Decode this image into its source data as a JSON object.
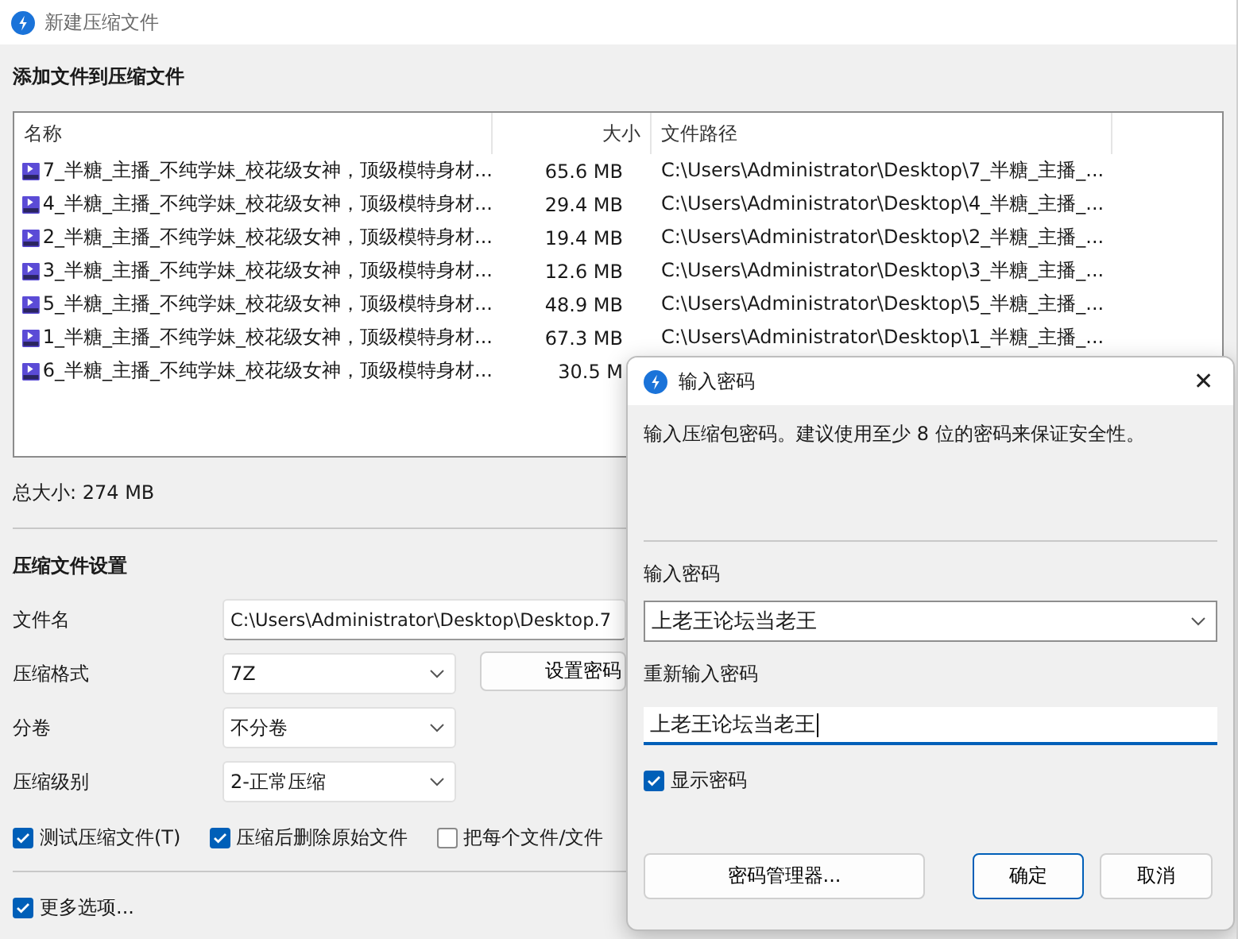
{
  "window": {
    "title": "新建压缩文件"
  },
  "heading": "添加文件到压缩文件",
  "list": {
    "columns": [
      "名称",
      "大小",
      "文件路径"
    ],
    "rows": [
      {
        "name": "7_半糖_主播_不纯学妹_校花级女神，顶级模特身材...",
        "size": "65.6 MB",
        "path": "C:\\Users\\Administrator\\Desktop\\7_半糖_主播_..."
      },
      {
        "name": "4_半糖_主播_不纯学妹_校花级女神，顶级模特身材...",
        "size": "29.4 MB",
        "path": "C:\\Users\\Administrator\\Desktop\\4_半糖_主播_..."
      },
      {
        "name": "2_半糖_主播_不纯学妹_校花级女神，顶级模特身材...",
        "size": "19.4 MB",
        "path": "C:\\Users\\Administrator\\Desktop\\2_半糖_主播_..."
      },
      {
        "name": "3_半糖_主播_不纯学妹_校花级女神，顶级模特身材...",
        "size": "12.6 MB",
        "path": "C:\\Users\\Administrator\\Desktop\\3_半糖_主播_..."
      },
      {
        "name": "5_半糖_主播_不纯学妹_校花级女神，顶级模特身材...",
        "size": "48.9 MB",
        "path": "C:\\Users\\Administrator\\Desktop\\5_半糖_主播_..."
      },
      {
        "name": "1_半糖_主播_不纯学妹_校花级女神，顶级模特身材...",
        "size": "67.3 MB",
        "path": "C:\\Users\\Administrator\\Desktop\\1_半糖_主播_..."
      },
      {
        "name": "6_半糖_主播_不纯学妹_校花级女神，顶级模特身材...",
        "size": "30.5 M"
      }
    ]
  },
  "total_size": "总大小: 274 MB",
  "settings": {
    "heading": "压缩文件设置",
    "fields": [
      {
        "label": "文件名",
        "kind": "text",
        "value": "C:\\Users\\Administrator\\Desktop\\Desktop.7"
      },
      {
        "label": "压缩格式",
        "kind": "select",
        "value": "7Z"
      },
      {
        "label": "分卷",
        "kind": "select",
        "value": "不分卷"
      },
      {
        "label": "压缩级别",
        "kind": "select",
        "value": "2-正常压缩"
      }
    ],
    "password_button": "设置密码",
    "options": [
      {
        "label": "测试压缩文件(T)",
        "checked": true
      },
      {
        "label": "压缩后删除原始文件",
        "checked": true
      },
      {
        "label": "把每个文件/文件",
        "checked": false
      }
    ],
    "more_options": {
      "label": "更多选项...",
      "checked": true
    }
  },
  "dialog": {
    "title": "输入密码",
    "close": "✕",
    "description": "输入压缩包密码。建议使用至少 8 位的密码来保证安全性。",
    "password_label": "输入密码",
    "password": "上老王论坛当老王",
    "confirm_label": "重新输入密码",
    "confirm": "上老王论坛当老王",
    "show_password": {
      "label": "显示密码",
      "checked": true
    },
    "buttons": [
      {
        "label": "密码管理器...",
        "kind": "manager"
      },
      {
        "label": "确定",
        "kind": "default"
      },
      {
        "label": "取消",
        "kind": "cancel"
      }
    ]
  }
}
